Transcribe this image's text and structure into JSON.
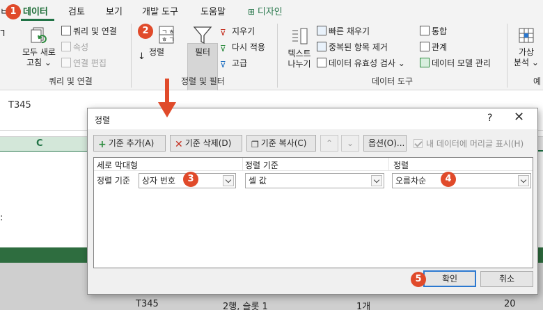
{
  "ribbon": {
    "tabs": [
      {
        "label": "데이터",
        "active": true
      },
      {
        "label": "검토"
      },
      {
        "label": "보기"
      },
      {
        "label": "개발 도구"
      },
      {
        "label": "도움말"
      },
      {
        "label": "디자인",
        "icon": "table-icon"
      }
    ],
    "query_group": {
      "refresh_all": "모두 새로",
      "refresh_all_2": "고침",
      "queries_connections": "쿼리 및 연결",
      "properties": "속성",
      "edit_links": "연결 편집",
      "label": "쿼리 및 연결"
    },
    "sort_filter_group": {
      "sort": "정렬",
      "filter": "필터",
      "clear": "지우기",
      "reapply": "다시 적용",
      "advanced": "고급",
      "label": "정렬 및 필터",
      "sort_icon_ga": "ㄱ",
      "sort_icon_ha": "ㅎ",
      "sort_icon_ha2": "ㅎ",
      "sort_icon_ga2": "ㄱ"
    },
    "data_tools_group": {
      "text_to_columns_1": "텍스트",
      "text_to_columns_2": "나누기",
      "flash_fill": "빠른 채우기",
      "remove_duplicates": "중복된 항목 제거",
      "data_validation": "데이터 유효성 검사",
      "consolidate": "통합",
      "relationships": "관계",
      "manage_data_model": "데이터 모델 관리",
      "label": "데이터 도구"
    },
    "forecast_group": {
      "what_if_1": "가상",
      "what_if_2": "분석",
      "label_partial": "예"
    }
  },
  "formula_bar": {
    "cell_ref": "T345"
  },
  "sheet": {
    "column_c": "C",
    "left_colon": ":",
    "bottom_row": {
      "ref": "T345",
      "location": "2행, 슬롯 1",
      "count": "1개",
      "value": "20"
    }
  },
  "sort_dialog": {
    "title": "정렬",
    "help": "?",
    "close": "✕",
    "add_level": "기준 추가(A)",
    "delete_level": "기준 삭제(D)",
    "copy_level": "기준 복사(C)",
    "options": "옵션(O)...",
    "my_data_has_headers": "내 데이터에 머리글 표시(H)",
    "headers_checked": true,
    "columns": {
      "column": "세로 막대형",
      "sort_on": "정렬 기준",
      "order": "정렬"
    },
    "row": {
      "label": "정렬 기준",
      "column_value": "상자 번호",
      "sort_on_value": "셀 값",
      "order_value": "오름차순"
    },
    "ok": "확인",
    "cancel": "취소"
  },
  "markers": [
    "1",
    "2",
    "3",
    "4",
    "5"
  ],
  "colors": {
    "excel_green": "#217346",
    "marker_red": "#e04a2a",
    "focus_blue": "#2b78d0"
  }
}
